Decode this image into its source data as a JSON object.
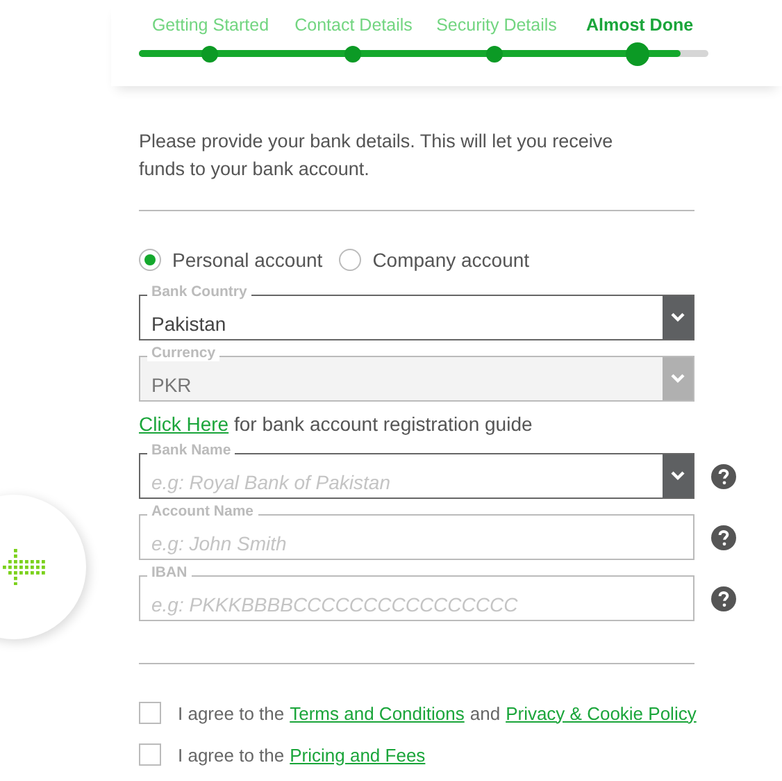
{
  "steps": [
    {
      "label": "Getting Started",
      "selected": false
    },
    {
      "label": "Contact Details",
      "selected": false
    },
    {
      "label": "Security Details",
      "selected": false
    },
    {
      "label": "Almost Done",
      "selected": true
    }
  ],
  "progress": {
    "level": 0.95
  },
  "intro": "Please provide your bank details. This will let you receive funds to your bank account.",
  "account_types": [
    {
      "label": "Personal account",
      "selected": true
    },
    {
      "label": "Company account",
      "selected": false
    }
  ],
  "bank_fields": [
    {
      "label": "Bank Country",
      "value": "Pakistan",
      "kind": "select",
      "disabled": false,
      "help": false
    },
    {
      "label": "Currency",
      "value": "PKR",
      "kind": "select",
      "disabled": true,
      "help": false
    }
  ],
  "guide": {
    "link": "Click Here",
    "text": "for bank account registration guide"
  },
  "account_fields": [
    {
      "label": "Bank Name",
      "placeholder": "e.g: Royal Bank of Pakistan",
      "kind": "select",
      "disabled": false,
      "help": true
    },
    {
      "label": "Account Name",
      "placeholder": "e.g: John Smith",
      "kind": "text",
      "disabled": false,
      "help": true
    },
    {
      "label": "IBAN",
      "placeholder": "e.g: PKKKBBBBCCCCCCCCCCCCCCCC",
      "kind": "text",
      "disabled": false,
      "help": true
    }
  ],
  "agreements": [
    {
      "checked": false,
      "segments": [
        {
          "text": "I agree to the",
          "link": false
        },
        {
          "text": "Terms and Conditions",
          "link": true
        },
        {
          "text": "and",
          "link": false
        },
        {
          "text": "Privacy & Cookie Policy",
          "link": true
        }
      ]
    },
    {
      "checked": false,
      "segments": [
        {
          "text": "I agree to the",
          "link": false
        },
        {
          "text": "Pricing and Fees",
          "link": true
        }
      ]
    }
  ]
}
